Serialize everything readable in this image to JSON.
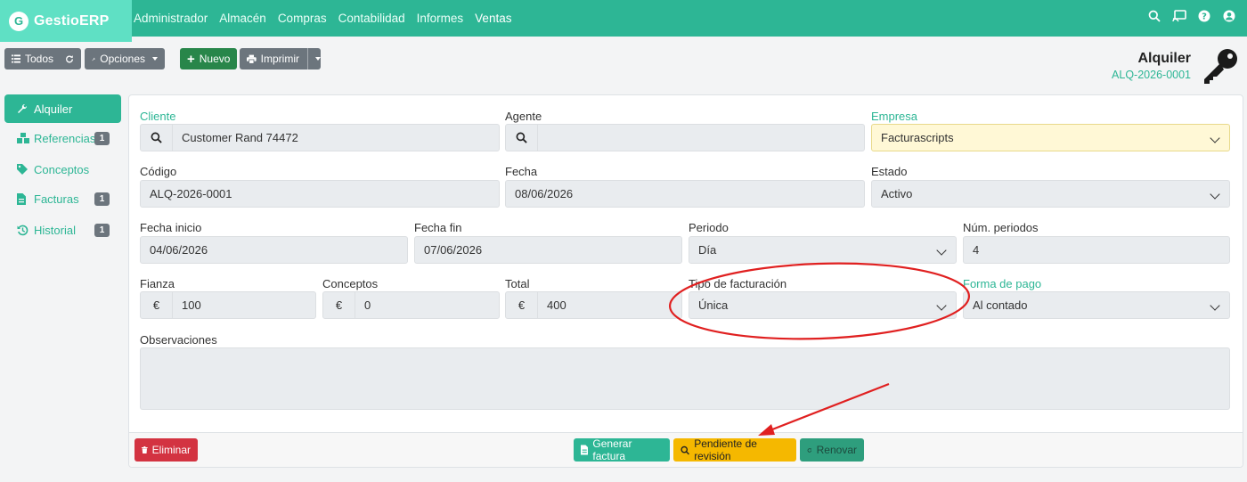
{
  "brand": {
    "logo_letter": "G",
    "name": "GestioERP"
  },
  "menu": [
    "Administrador",
    "Almacén",
    "Compras",
    "Contabilidad",
    "Informes",
    "Ventas"
  ],
  "nav_icons": [
    "search-icon",
    "cast-icon",
    "help-icon",
    "user-icon"
  ],
  "toolbar": {
    "all_label": "Todos",
    "options_label": "Opciones",
    "new_label": "Nuevo",
    "print_label": "Imprimir"
  },
  "document": {
    "title": "Alquiler",
    "code": "ALQ-2026-0001"
  },
  "sidebar": [
    {
      "label": "Alquiler",
      "icon": "wrench-icon",
      "badge": null
    },
    {
      "label": "Referencias",
      "icon": "boxes-icon",
      "badge": "1"
    },
    {
      "label": "Conceptos",
      "icon": "tags-icon",
      "badge": null
    },
    {
      "label": "Facturas",
      "icon": "file-invoice-icon",
      "badge": "1"
    },
    {
      "label": "Historial",
      "icon": "history-icon",
      "badge": "1"
    }
  ],
  "form": {
    "cliente": {
      "label": "Cliente",
      "value": "Customer Rand 74472"
    },
    "agente": {
      "label": "Agente",
      "value": ""
    },
    "empresa": {
      "label": "Empresa",
      "value": "Facturascripts"
    },
    "codigo": {
      "label": "Código",
      "value": "ALQ-2026-0001"
    },
    "fecha": {
      "label": "Fecha",
      "value": "08/06/2026"
    },
    "estado": {
      "label": "Estado",
      "value": "Activo"
    },
    "fecha_inicio": {
      "label": "Fecha inicio",
      "value": "04/06/2026"
    },
    "fecha_fin": {
      "label": "Fecha fin",
      "value": "07/06/2026"
    },
    "periodo": {
      "label": "Periodo",
      "value": "Día"
    },
    "num_periodos": {
      "label": "Núm. periodos",
      "value": "4"
    },
    "fianza": {
      "label": "Fianza",
      "value": "100",
      "currency": "€"
    },
    "conceptos": {
      "label": "Conceptos",
      "value": "0",
      "currency": "€"
    },
    "total": {
      "label": "Total",
      "value": "400",
      "currency": "€"
    },
    "tipo_facturacion": {
      "label": "Tipo de facturación",
      "value": "Única"
    },
    "forma_pago": {
      "label": "Forma de pago",
      "value": "Al contado"
    },
    "observaciones": {
      "label": "Observaciones",
      "value": ""
    }
  },
  "footer": {
    "delete_label": "Eliminar",
    "generate_label": "Generar factura",
    "pending_label": "Pendiente de revisión",
    "renew_label": "Renovar"
  },
  "colors": {
    "primary": "#2db695",
    "danger": "#d33341",
    "warning": "#f5b800",
    "annotation": "#e02020"
  }
}
